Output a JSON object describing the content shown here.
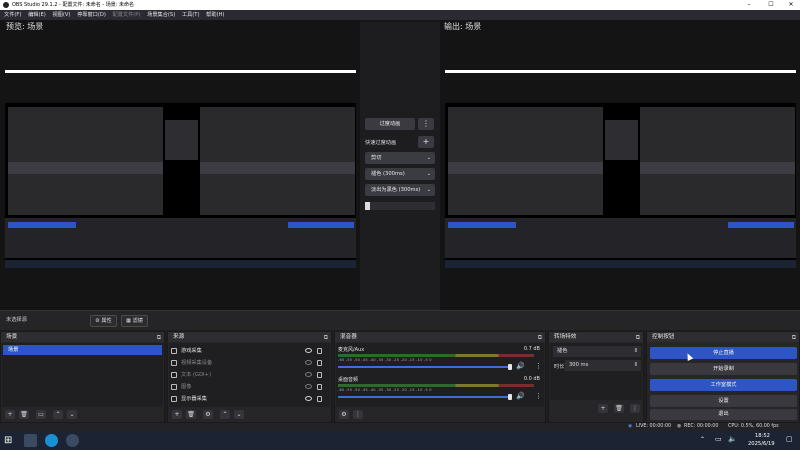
{
  "window": {
    "title": "OBS Studio 29.1.2 - 配置文件: 未命名 - 场景: 未命名",
    "minimize": "–",
    "maximize": "☐",
    "close": "✕"
  },
  "menu": {
    "items": [
      {
        "label": "文件(F)",
        "disabled": false
      },
      {
        "label": "编辑(E)",
        "disabled": false
      },
      {
        "label": "视图(V)",
        "disabled": false
      },
      {
        "label": "停靠窗口(D)",
        "disabled": false
      },
      {
        "label": "配置文件(P)",
        "disabled": true
      },
      {
        "label": "场景集合(S)",
        "disabled": false
      },
      {
        "label": "工具(T)",
        "disabled": false
      },
      {
        "label": "帮助(H)",
        "disabled": false
      }
    ]
  },
  "preview": {
    "label": "预览: 场景"
  },
  "program": {
    "label": "输出: 场景"
  },
  "transition_panel": {
    "transition_button": "过度动画",
    "quick_transitions": "快速过度动画",
    "cut": "剪切",
    "fade": "褪色 (300ms)",
    "fade_black": "淡出为黑色 (300ms)",
    "more": "⋮",
    "add": "+"
  },
  "scene_bar": {
    "label": "未选择源",
    "properties": "属性",
    "filters": "滤镜"
  },
  "scenes": {
    "title": "场景",
    "items": [
      {
        "name": "场景",
        "selected": true
      }
    ]
  },
  "sources": {
    "title": "来源",
    "items": [
      {
        "name": "游戏采集",
        "visible": true,
        "hidden": false
      },
      {
        "name": "视频采集设备",
        "visible": false,
        "hidden": true
      },
      {
        "name": "文本 (GDI+)",
        "visible": false,
        "hidden": true
      },
      {
        "name": "图像",
        "visible": false,
        "hidden": true
      },
      {
        "name": "显示器采集",
        "visible": true,
        "hidden": false
      }
    ]
  },
  "mixer": {
    "title": "混音器",
    "scale": "-60 -55 -50 -45 -40 -35 -30 -25 -20 -15 -10 -5 0",
    "channels": [
      {
        "name": "麦克风/Aux",
        "db": "0.7 dB",
        "level": 0.87
      },
      {
        "name": "桌面音频",
        "db": "0.0 dB",
        "level": 0.86
      }
    ]
  },
  "transitions": {
    "title": "转场特效",
    "selected": "褪色",
    "duration_label": "时长",
    "duration_value": "300 ms"
  },
  "controls": {
    "title": "控制按钮",
    "buttons": [
      {
        "label": "停止直播",
        "active": true
      },
      {
        "label": "开始录制",
        "active": false
      },
      {
        "label": "工作室模式",
        "active": true
      },
      {
        "label": "设置",
        "active": false
      },
      {
        "label": "退出",
        "active": false
      }
    ]
  },
  "status": {
    "live": "LIVE: 00:00:00",
    "rec": "REC: 00:00:00",
    "cpu": "CPU: 0.5%, 60.00 fps"
  },
  "taskbar": {
    "time": "18:52",
    "date": "2025/6/19"
  },
  "colors": {
    "accent": "#2d55c8",
    "panel": "#262528",
    "background": "#1f1e1f"
  }
}
